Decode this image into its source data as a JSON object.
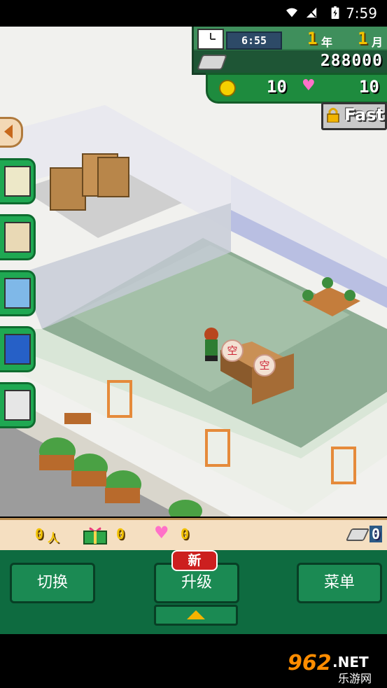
{
  "status_bar": {
    "time": "7:59"
  },
  "hud": {
    "clock_time": "6:55",
    "year": "1",
    "year_unit": "年",
    "month": "1",
    "month_unit": "月",
    "money": "288000",
    "coins": "10",
    "hearts": "10",
    "fast_label": "Fast"
  },
  "scene": {
    "bubble_1": "空",
    "bubble_2": "空"
  },
  "info_bar": {
    "people_count": "0",
    "people_unit": "人",
    "gift_count": "0",
    "heart_count": "0",
    "ticket_count": "0"
  },
  "menu": {
    "switch_label": "切换",
    "upgrade_label": "升级",
    "new_badge": "新",
    "menu_label": "菜单"
  },
  "watermark": {
    "brand": "962",
    "suffix": ".NET",
    "sub": "乐游网"
  },
  "colors": {
    "menu_bg": "#0e6b40",
    "button_bg": "#1b8a53",
    "badge_red": "#cc1f1f",
    "gold": "#f2c200"
  }
}
